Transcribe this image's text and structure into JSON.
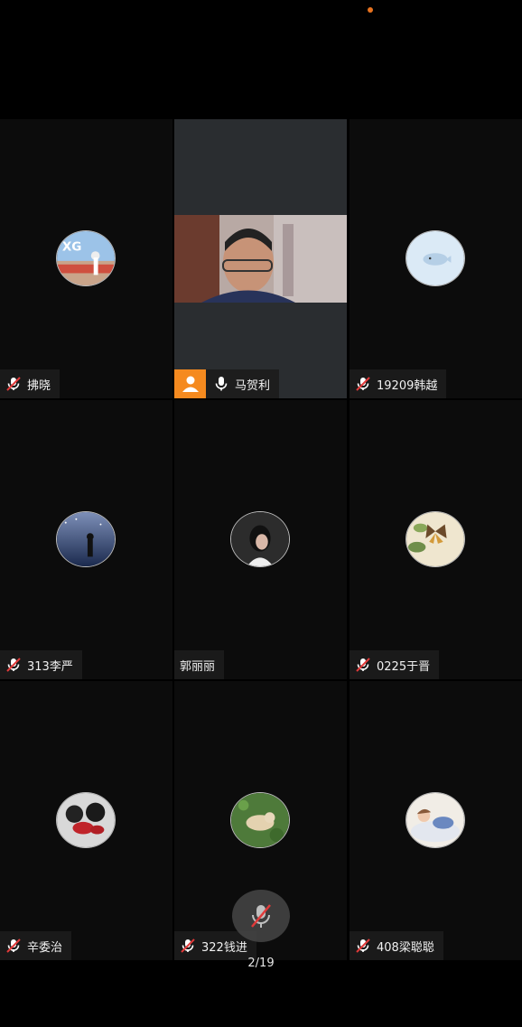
{
  "colors": {
    "accent": "#f58a1f",
    "muted_red": "#e03a3a",
    "tile_bg": "#0c0c0c"
  },
  "participants": [
    {
      "name": "拂晓",
      "mic": "muted",
      "avatar": "photo"
    },
    {
      "name": "马贺利",
      "mic": "on",
      "host": true,
      "video": true
    },
    {
      "name": "19209韩越",
      "mic": "muted",
      "avatar": "whale-icon"
    },
    {
      "name": "313李严",
      "mic": "muted",
      "avatar": "photo"
    },
    {
      "name": "郭丽丽",
      "mic": "none",
      "avatar": "photo"
    },
    {
      "name": "0225于晋",
      "mic": "muted",
      "avatar": "butterfly-icon"
    },
    {
      "name": "辛委治",
      "mic": "muted",
      "avatar": "photo"
    },
    {
      "name": "322钱进",
      "mic": "muted",
      "avatar": "photo"
    },
    {
      "name": "408梁聪聪",
      "mic": "muted",
      "avatar": "photo"
    }
  ],
  "pager": {
    "label": "2/19"
  }
}
